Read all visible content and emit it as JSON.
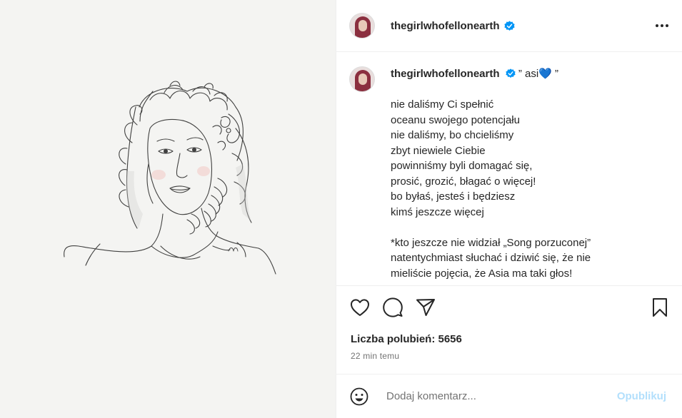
{
  "post": {
    "username": "thegirlwhofellonearth",
    "caption_title": "” asi💙 ”",
    "caption_lines": [
      "nie daliśmy Ci spełnić",
      "oceanu swojego potencjału",
      "nie daliśmy, bo chcieliśmy",
      "zbyt niewiele Ciebie",
      "powinniśmy byli domagać się,",
      "prosić, grozić, błagać o więcej!",
      "bo byłaś, jesteś i będziesz",
      "kimś jeszcze więcej",
      "",
      "*kto jeszcze nie widział „Song porzuconej”",
      "natentychmiast słuchać i dziwić się, że nie",
      "mieliście pojęcia, że Asia ma taki głos!"
    ],
    "likes_text": "Liczba polubień: 5656",
    "time_text": "22 min temu"
  },
  "comment": {
    "placeholder": "Dodaj komentarz...",
    "publish_label": "Opublikuj"
  },
  "icons": {
    "verified": "verified-badge-icon",
    "more": "more-options-icon",
    "like": "heart-icon",
    "comment": "comment-icon",
    "share": "share-icon",
    "save": "bookmark-icon",
    "emoji": "emoji-icon"
  },
  "colors": {
    "verified_blue": "#0095f6",
    "publish_disabled": "#b2dffc"
  }
}
